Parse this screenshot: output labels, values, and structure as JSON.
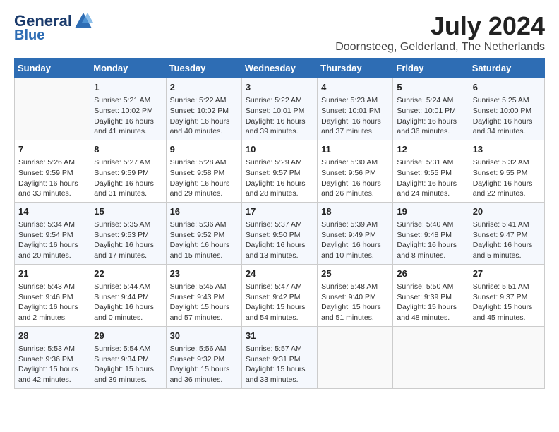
{
  "logo": {
    "text_general": "General",
    "text_blue": "Blue"
  },
  "title": "July 2024",
  "subtitle": "Doornsteeg, Gelderland, The Netherlands",
  "days_header": [
    "Sunday",
    "Monday",
    "Tuesday",
    "Wednesday",
    "Thursday",
    "Friday",
    "Saturday"
  ],
  "weeks": [
    [
      {
        "day": "",
        "content": ""
      },
      {
        "day": "1",
        "content": "Sunrise: 5:21 AM\nSunset: 10:02 PM\nDaylight: 16 hours\nand 41 minutes."
      },
      {
        "day": "2",
        "content": "Sunrise: 5:22 AM\nSunset: 10:02 PM\nDaylight: 16 hours\nand 40 minutes."
      },
      {
        "day": "3",
        "content": "Sunrise: 5:22 AM\nSunset: 10:01 PM\nDaylight: 16 hours\nand 39 minutes."
      },
      {
        "day": "4",
        "content": "Sunrise: 5:23 AM\nSunset: 10:01 PM\nDaylight: 16 hours\nand 37 minutes."
      },
      {
        "day": "5",
        "content": "Sunrise: 5:24 AM\nSunset: 10:01 PM\nDaylight: 16 hours\nand 36 minutes."
      },
      {
        "day": "6",
        "content": "Sunrise: 5:25 AM\nSunset: 10:00 PM\nDaylight: 16 hours\nand 34 minutes."
      }
    ],
    [
      {
        "day": "7",
        "content": "Sunrise: 5:26 AM\nSunset: 9:59 PM\nDaylight: 16 hours\nand 33 minutes."
      },
      {
        "day": "8",
        "content": "Sunrise: 5:27 AM\nSunset: 9:59 PM\nDaylight: 16 hours\nand 31 minutes."
      },
      {
        "day": "9",
        "content": "Sunrise: 5:28 AM\nSunset: 9:58 PM\nDaylight: 16 hours\nand 29 minutes."
      },
      {
        "day": "10",
        "content": "Sunrise: 5:29 AM\nSunset: 9:57 PM\nDaylight: 16 hours\nand 28 minutes."
      },
      {
        "day": "11",
        "content": "Sunrise: 5:30 AM\nSunset: 9:56 PM\nDaylight: 16 hours\nand 26 minutes."
      },
      {
        "day": "12",
        "content": "Sunrise: 5:31 AM\nSunset: 9:55 PM\nDaylight: 16 hours\nand 24 minutes."
      },
      {
        "day": "13",
        "content": "Sunrise: 5:32 AM\nSunset: 9:55 PM\nDaylight: 16 hours\nand 22 minutes."
      }
    ],
    [
      {
        "day": "14",
        "content": "Sunrise: 5:34 AM\nSunset: 9:54 PM\nDaylight: 16 hours\nand 20 minutes."
      },
      {
        "day": "15",
        "content": "Sunrise: 5:35 AM\nSunset: 9:53 PM\nDaylight: 16 hours\nand 17 minutes."
      },
      {
        "day": "16",
        "content": "Sunrise: 5:36 AM\nSunset: 9:52 PM\nDaylight: 16 hours\nand 15 minutes."
      },
      {
        "day": "17",
        "content": "Sunrise: 5:37 AM\nSunset: 9:50 PM\nDaylight: 16 hours\nand 13 minutes."
      },
      {
        "day": "18",
        "content": "Sunrise: 5:39 AM\nSunset: 9:49 PM\nDaylight: 16 hours\nand 10 minutes."
      },
      {
        "day": "19",
        "content": "Sunrise: 5:40 AM\nSunset: 9:48 PM\nDaylight: 16 hours\nand 8 minutes."
      },
      {
        "day": "20",
        "content": "Sunrise: 5:41 AM\nSunset: 9:47 PM\nDaylight: 16 hours\nand 5 minutes."
      }
    ],
    [
      {
        "day": "21",
        "content": "Sunrise: 5:43 AM\nSunset: 9:46 PM\nDaylight: 16 hours\nand 2 minutes."
      },
      {
        "day": "22",
        "content": "Sunrise: 5:44 AM\nSunset: 9:44 PM\nDaylight: 16 hours\nand 0 minutes."
      },
      {
        "day": "23",
        "content": "Sunrise: 5:45 AM\nSunset: 9:43 PM\nDaylight: 15 hours\nand 57 minutes."
      },
      {
        "day": "24",
        "content": "Sunrise: 5:47 AM\nSunset: 9:42 PM\nDaylight: 15 hours\nand 54 minutes."
      },
      {
        "day": "25",
        "content": "Sunrise: 5:48 AM\nSunset: 9:40 PM\nDaylight: 15 hours\nand 51 minutes."
      },
      {
        "day": "26",
        "content": "Sunrise: 5:50 AM\nSunset: 9:39 PM\nDaylight: 15 hours\nand 48 minutes."
      },
      {
        "day": "27",
        "content": "Sunrise: 5:51 AM\nSunset: 9:37 PM\nDaylight: 15 hours\nand 45 minutes."
      }
    ],
    [
      {
        "day": "28",
        "content": "Sunrise: 5:53 AM\nSunset: 9:36 PM\nDaylight: 15 hours\nand 42 minutes."
      },
      {
        "day": "29",
        "content": "Sunrise: 5:54 AM\nSunset: 9:34 PM\nDaylight: 15 hours\nand 39 minutes."
      },
      {
        "day": "30",
        "content": "Sunrise: 5:56 AM\nSunset: 9:32 PM\nDaylight: 15 hours\nand 36 minutes."
      },
      {
        "day": "31",
        "content": "Sunrise: 5:57 AM\nSunset: 9:31 PM\nDaylight: 15 hours\nand 33 minutes."
      },
      {
        "day": "",
        "content": ""
      },
      {
        "day": "",
        "content": ""
      },
      {
        "day": "",
        "content": ""
      }
    ]
  ]
}
